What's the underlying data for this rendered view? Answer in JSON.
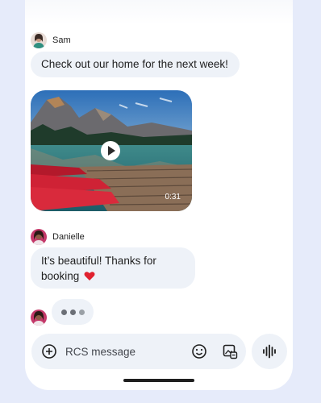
{
  "colors": {
    "background": "#e6ebfa",
    "bubble": "#eef2f8",
    "heart": "#e0212f"
  },
  "messages": [
    {
      "sender": "Sam",
      "text": "Check out our home for the next week!"
    },
    {
      "sender": "Sam",
      "media": {
        "type": "video",
        "duration": "0:31"
      }
    },
    {
      "sender": "Danielle",
      "text_line1": "It’s beautiful! Thanks for",
      "text_line2": "booking",
      "emoji": "heart"
    }
  ],
  "typing_indicator": {
    "visible": true
  },
  "composer": {
    "placeholder": "RCS message",
    "icons": [
      "add-icon",
      "emoji-icon",
      "gallery-icon",
      "voice-waveform-icon"
    ]
  }
}
